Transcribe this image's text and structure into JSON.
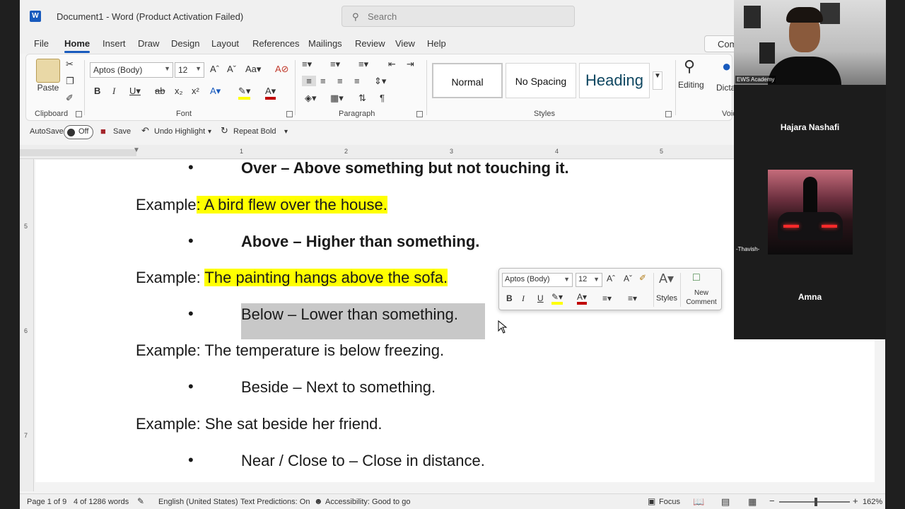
{
  "window": {
    "app_logo": "W",
    "title": "Document1  -  Word (Product Activation Failed)",
    "search_placeholder": "Search"
  },
  "tabs": [
    "File",
    "Home",
    "Insert",
    "Draw",
    "Design",
    "Layout",
    "References",
    "Mailings",
    "Review",
    "View",
    "Help"
  ],
  "comments_button": "Com",
  "ribbon": {
    "clipboard": {
      "paste": "Paste",
      "label": "Clipboard"
    },
    "font": {
      "name": "Aptos (Body)",
      "size": "12",
      "label": "Font"
    },
    "paragraph": {
      "label": "Paragraph"
    },
    "styles": {
      "normal": "Normal",
      "no_spacing": "No Spacing",
      "heading": "Heading",
      "label": "Styles"
    },
    "editing": {
      "label": "Editing"
    },
    "dictate": {
      "label": "Dicta",
      "voice": "Voic"
    }
  },
  "qat": {
    "autosave": "AutoSave",
    "autosave_state": "Off",
    "save": "Save",
    "undo": "Undo Highlight",
    "repeat": "Repeat Bold"
  },
  "ruler": {
    "h": [
      "1",
      "2",
      "3",
      "4",
      "5"
    ],
    "v": [
      "5",
      "6",
      "7"
    ]
  },
  "document": {
    "b1": "Over – Above something but not touching it.",
    "e1_prefix": "Example",
    "e1_hl": ": A bird flew over the house.",
    "b2": "Above – Higher than something.",
    "e2_prefix": "Example: ",
    "e2_hl": "The painting hangs above the sofa.",
    "b3": "Below – Lower than something.",
    "e3": "Example: The temperature is below freezing.",
    "b4": "Beside – Next to something.",
    "e4": "Example: She sat beside her friend.",
    "b5": "Near / Close to – Close in distance.",
    "bullet": "•"
  },
  "mini_toolbar": {
    "font": "Aptos (Body)",
    "size": "12",
    "styles": "Styles",
    "new_comment_1": "New",
    "new_comment_2": "Comment"
  },
  "status_bar": {
    "page": "Page 1 of 9",
    "words": "4 of 1286 words",
    "language": "English (United States)",
    "predictions": "Text Predictions: On",
    "accessibility": "Accessibility: Good to go",
    "focus": "Focus",
    "zoom": "162%"
  },
  "video": {
    "tag": "EWS Academy",
    "participant1": "Hajara Nashafi",
    "participant2_tag": "-Thavish-",
    "participant3": "Amna"
  },
  "colors": {
    "accent": "#185abd",
    "highlight": "#ffff00",
    "selection": "#c8c8c8"
  }
}
